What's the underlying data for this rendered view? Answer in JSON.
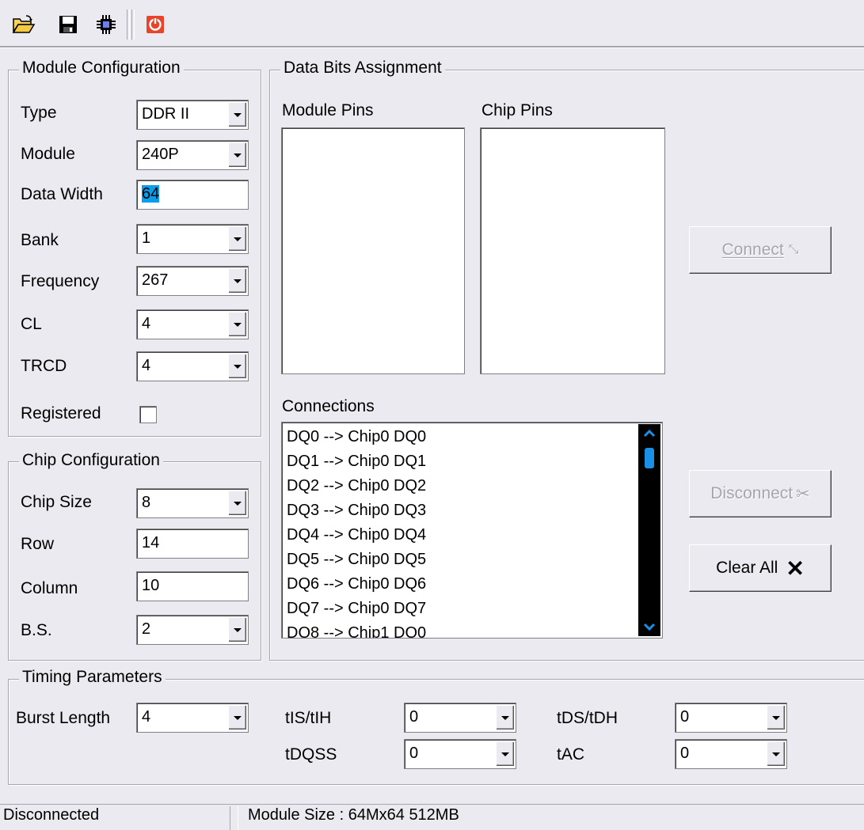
{
  "toolbar": {
    "open_icon": "folder-open-icon",
    "save_icon": "floppy-disk-icon",
    "chip_icon": "chip-icon",
    "power_icon": "power-icon"
  },
  "module_config": {
    "title": "Module Configuration",
    "type_label": "Type",
    "type_value": "DDR II",
    "module_label": "Module",
    "module_value": "240P",
    "data_width_label": "Data Width",
    "data_width_value": "64",
    "bank_label": "Bank",
    "bank_value": "1",
    "frequency_label": "Frequency",
    "frequency_value": "267",
    "cl_label": "CL",
    "cl_value": "4",
    "trcd_label": "TRCD",
    "trcd_value": "4",
    "registered_label": "Registered"
  },
  "chip_config": {
    "title": "Chip Configuration",
    "chip_size_label": "Chip Size",
    "chip_size_value": "8",
    "row_label": "Row",
    "row_value": "14",
    "column_label": "Column",
    "column_value": "10",
    "bs_label": "B.S.",
    "bs_value": "2"
  },
  "data_bits": {
    "title": "Data Bits Assignment",
    "module_pins_label": "Module Pins",
    "chip_pins_label": "Chip Pins",
    "connections_label": "Connections",
    "connections": [
      "DQ0 --> Chip0 DQ0",
      "DQ1 --> Chip0 DQ1",
      "DQ2 --> Chip0 DQ2",
      "DQ3 --> Chip0 DQ3",
      "DQ4 --> Chip0 DQ4",
      "DQ5 --> Chip0 DQ5",
      "DQ6 --> Chip0 DQ6",
      "DQ7 --> Chip0 DQ7",
      "DQ8 --> Chip1 DQ0"
    ],
    "connect_button": "Connect",
    "disconnect_button": "Disconnect",
    "clear_all_button": "Clear All"
  },
  "timing": {
    "title": "Timing Parameters",
    "burst_length_label": "Burst Length",
    "burst_length_value": "4",
    "tis_label": "tIS/tIH",
    "tis_value": "0",
    "tdqss_label": "tDQSS",
    "tdqss_value": "0",
    "tds_label": "tDS/tDH",
    "tds_value": "0",
    "tac_label": "tAC",
    "tac_value": "0"
  },
  "status": {
    "connection": "Disconnected",
    "module_size": "Module Size : 64Mx64 512MB"
  }
}
